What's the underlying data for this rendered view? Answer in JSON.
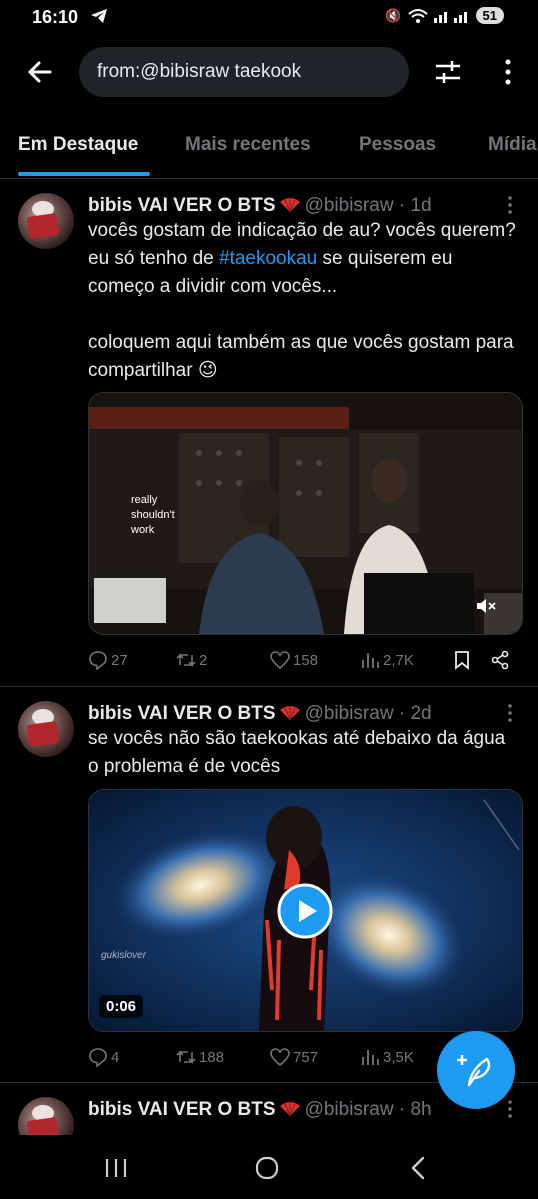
{
  "status_bar": {
    "time": "16:10",
    "battery": "51"
  },
  "search": {
    "query": "from:@bibisraw taekook"
  },
  "tabs": [
    {
      "label": "Em Destaque",
      "active": true
    },
    {
      "label": "Mais recentes",
      "active": false
    },
    {
      "label": "Pessoas",
      "active": false
    },
    {
      "label": "Mídia",
      "active": false
    }
  ],
  "tweets": [
    {
      "name": "bibis VAI VER O BTS",
      "handle": "@bibisraw",
      "time": "1d",
      "text_before_tag": "vocês gostam de indicação de au? vocês querem? eu só tenho de ",
      "hashtag": "#taekookau",
      "text_after_tag": "  se quiserem eu começo a dividir com vocês...",
      "text2": "coloquem aqui também as que vocês gostam para compartilhar 😉",
      "media_caption": "really shouldn't work",
      "replies": "27",
      "retweets": "2",
      "likes": "158",
      "views": "2,7K"
    },
    {
      "name": "bibis VAI VER O BTS",
      "handle": "@bibisraw",
      "time": "2d",
      "text": "se vocês não são taekookas até debaixo da água o problema é de vocês",
      "video_duration": "0:06",
      "watermark": "gukislover",
      "replies": "4",
      "retweets": "188",
      "likes": "757",
      "views": "3,5K"
    },
    {
      "name": "bibis VAI VER O BTS",
      "handle": "@bibisraw",
      "time": "8h"
    }
  ],
  "colors": {
    "accent": "#1d9bf0",
    "background": "#000000",
    "muted": "#71767b",
    "text": "#e7e9ea"
  },
  "icons": [
    "back-arrow-icon",
    "filter-icon",
    "more-vertical-icon",
    "reply-icon",
    "retweet-icon",
    "like-icon",
    "views-icon",
    "bookmark-icon",
    "share-icon",
    "compose-icon",
    "play-icon",
    "mute-icon"
  ]
}
